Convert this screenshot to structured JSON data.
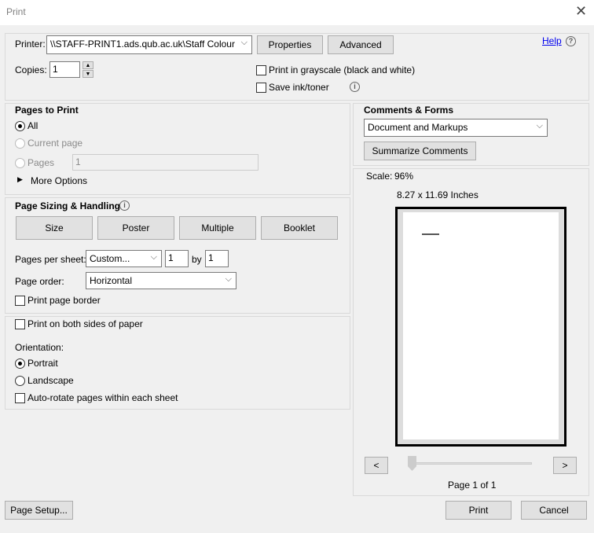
{
  "window": {
    "title": "Print",
    "close_icon": "close-icon"
  },
  "printer": {
    "label": "Printer:",
    "value": "\\\\STAFF-PRINT1.ads.qub.ac.uk\\Staff Colour",
    "properties": "Properties",
    "advanced": "Advanced",
    "help": "Help"
  },
  "copies": {
    "label": "Copies:",
    "value": "1"
  },
  "options": {
    "grayscale": "Print in grayscale (black and white)",
    "save_ink": "Save ink/toner"
  },
  "pages_to_print": {
    "title": "Pages to Print",
    "all": "All",
    "current": "Current page",
    "pages": "Pages",
    "pages_value": "1",
    "more": "More Options"
  },
  "sizing": {
    "title": "Page Sizing & Handling",
    "tabs": [
      "Size",
      "Poster",
      "Multiple",
      "Booklet"
    ],
    "pps_label": "Pages per sheet:",
    "pps_value": "Custom...",
    "cols": "1",
    "by": "by",
    "rows": "1",
    "order_label": "Page order:",
    "order_value": "Horizontal",
    "border": "Print page border"
  },
  "duplex": {
    "both_sides": "Print on both sides of paper",
    "orientation": "Orientation:",
    "portrait": "Portrait",
    "landscape": "Landscape",
    "autorotate": "Auto-rotate pages within each sheet"
  },
  "comments": {
    "title": "Comments & Forms",
    "value": "Document and Markups",
    "summarize": "Summarize Comments"
  },
  "preview": {
    "scale_label": "Scale:",
    "scale": "96%",
    "size": "8.27 x 11.69 Inches",
    "prev": "<",
    "next": ">",
    "page": "Page 1 of 1"
  },
  "footer": {
    "page_setup": "Page Setup...",
    "print": "Print",
    "cancel": "Cancel"
  }
}
